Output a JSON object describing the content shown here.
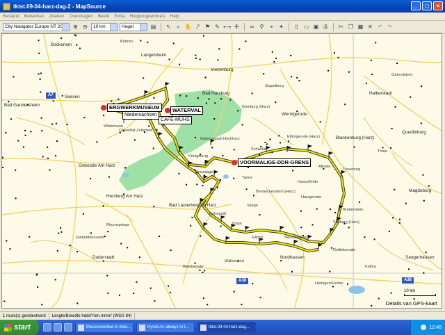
{
  "window": {
    "title": "tktst.09-04-harz-dag-2 - MapSource"
  },
  "menu": [
    "Bestand",
    "Bewerken",
    "Zoeken",
    "Overdragen",
    "Beeld",
    "Extra",
    "Hulpprogramma's",
    "Help"
  ],
  "toolbar": {
    "map_product": "City Navigator Europe NT 2008",
    "zoom": "10 km",
    "detail": "Hoger"
  },
  "waypoints": {
    "bergwerk": "ERGWERKMUSEUM",
    "niedersachsen": "Niedersachsen",
    "cafe": "CAFE-MUHS",
    "waterval": "WATERVAL",
    "grens": "VOORMALIGE-DDR-GRENS"
  },
  "places": [
    "Bockenem",
    "Bühren",
    "Langelsheim",
    "Vienenburg",
    "Bad Harzburg",
    "Stapelburg",
    "Ilsenburg (Harz)",
    "Wernigerode",
    "Halberstadt",
    "Seesen",
    "Bad Gandersheim",
    "Wildemann",
    "Clausthal-Zellerfeld",
    "Nationalpark Hochharz",
    "Schierke",
    "Elbingerode (Harz)",
    "Blankenburg (Harz)",
    "Quedlinburg",
    "Thale",
    "Osterode Am Harz",
    "Königskrug",
    "Braunlage",
    "Tanne",
    "Benneckenstein (Harz)",
    "Hasselfelde",
    "Allrode",
    "Treseburg",
    "Herzberg Am Harz",
    "Bad Lauterberg Im Harz",
    "Hohegeiß",
    "Stiege",
    "Harzgerode",
    "Rhumspringe",
    "Gieboldehausen",
    "Duderstadt",
    "Zorge",
    "Ellrich",
    "Neustadt/Harz",
    "Nordhausen",
    "Breitenstein",
    "Stolberg (Harz)",
    "Rottleberode",
    "Bleicherode",
    "Sangerhausen",
    "Kelbra",
    "Heringen/Helme",
    "Walkenried",
    "Gatersleben",
    "Magdeburg"
  ],
  "shields": {
    "a7": "A7",
    "a38_left": "A38",
    "a38_right": "A38"
  },
  "scale": "10 km",
  "credit": "Details van GPS-kaart",
  "status": {
    "selection": "1 route(s) geselecteerd",
    "coords": "Lengte/Breedte hddd°mm.mmm' (WGS 84)"
  },
  "taskbar": {
    "start": "start",
    "tasks": [
      "Messenverbod in dele...",
      "Hyves.nl: always in t...",
      "tktst.09-04-harz-dag..."
    ],
    "clock": "12:48"
  },
  "colors": {
    "map_bg": "#fdfbe8",
    "forest": "#9ee0a6",
    "route": "#f2e400",
    "road": "#f4d36c",
    "title_blue": "#0842b8"
  }
}
